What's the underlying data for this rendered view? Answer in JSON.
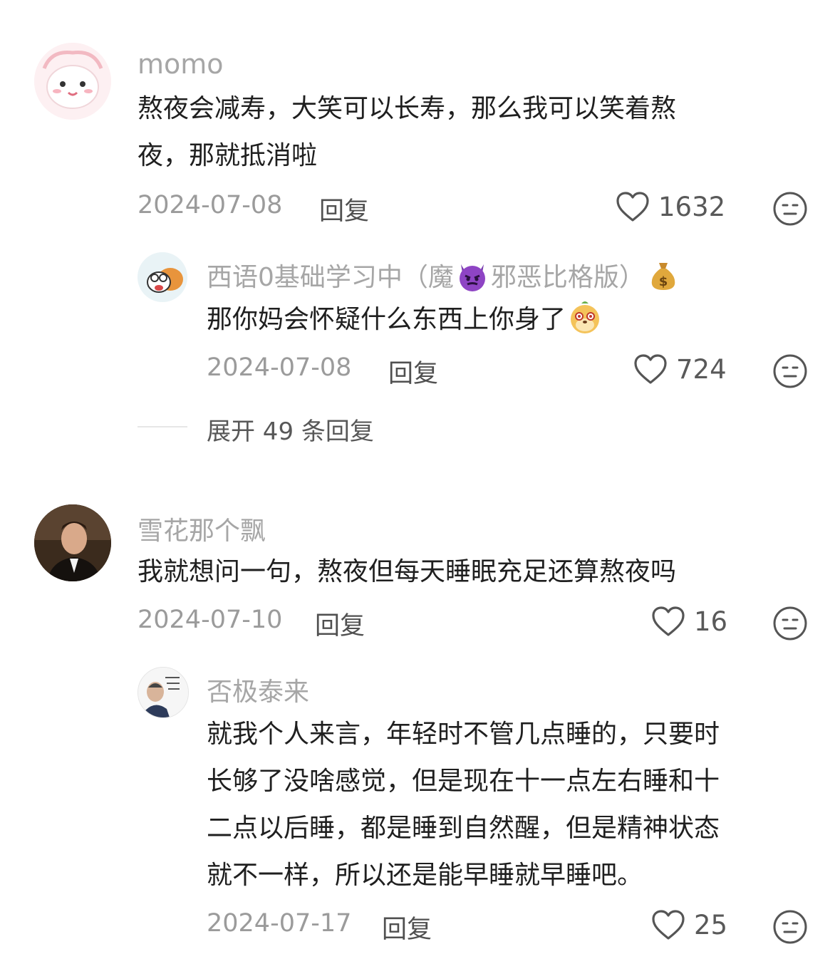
{
  "comments": [
    {
      "user": "momo",
      "text_lines": [
        "熬夜会减寿，大笑可以长寿，那么我可以笑着熬",
        "夜，那就抵消啦"
      ],
      "date": "2024-07-08",
      "reply_label": "回复",
      "likes": "1632",
      "avatar_icon": "cute-bunny-avatar",
      "replies": [
        {
          "user_prefix": "西语0基础学习中（魔",
          "user_suffix": "邪恶比格版）",
          "user_icons": [
            "devil-emoji-icon",
            "money-bag-emoji-icon"
          ],
          "text": "那你妈会怀疑什么东西上你身了",
          "text_icon": "mole-face-emoji-icon",
          "date": "2024-07-08",
          "reply_label": "回复",
          "likes": "724",
          "avatar_icon": "cartoon-dog-avatar"
        }
      ],
      "expand_label": "展开 49 条回复"
    },
    {
      "user": "雪花那个飘",
      "text_lines": [
        "我就想问一句，熬夜但每天睡眠充足还算熬夜吗"
      ],
      "date": "2024-07-10",
      "reply_label": "回复",
      "likes": "16",
      "avatar_icon": "man-in-suit-avatar",
      "replies": [
        {
          "user": "否极泰来",
          "text_lines": [
            "就我个人来言，年轻时不管几点睡的，只要时",
            "长够了没啥感觉，但是现在十一点左右睡和十",
            "二点以后睡，都是睡到自然醒，但是精神状态",
            "就不一样，所以还是能早睡就早睡吧。"
          ],
          "date": "2024-07-17",
          "reply_label": "回复",
          "likes": "25",
          "avatar_icon": "sticker-avatar"
        }
      ]
    }
  ],
  "colors": {
    "name": "#a6a6a6",
    "text": "#1f1f1f",
    "date": "#9b9b9b",
    "icon": "#555555"
  }
}
